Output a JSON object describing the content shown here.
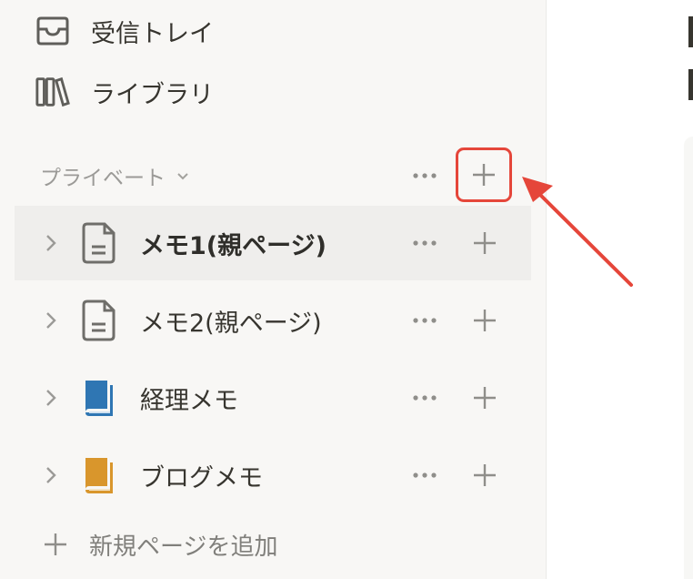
{
  "sidebar": {
    "inbox_label": "受信トレイ",
    "library_label": "ライブラリ",
    "section": {
      "label": "プライベート"
    },
    "pages": [
      {
        "title": "メモ1(親ページ)",
        "icon": "document-icon",
        "selected": true
      },
      {
        "title": "メモ2(親ページ)",
        "icon": "document-icon",
        "selected": false
      },
      {
        "title": "経理メモ",
        "icon": "blue-book-icon",
        "icon_color": "#2f76b3",
        "selected": false
      },
      {
        "title": "ブログメモ",
        "icon": "orange-book-icon",
        "icon_color": "#d9962c",
        "selected": false
      }
    ],
    "add_page_label": "新規ページを追加"
  },
  "colors": {
    "sidebar_bg": "#f8f7f5",
    "selected_row_bg": "#efeeec",
    "highlight": "#e5463a",
    "text": "#37352f",
    "muted": "#9b9a97"
  }
}
